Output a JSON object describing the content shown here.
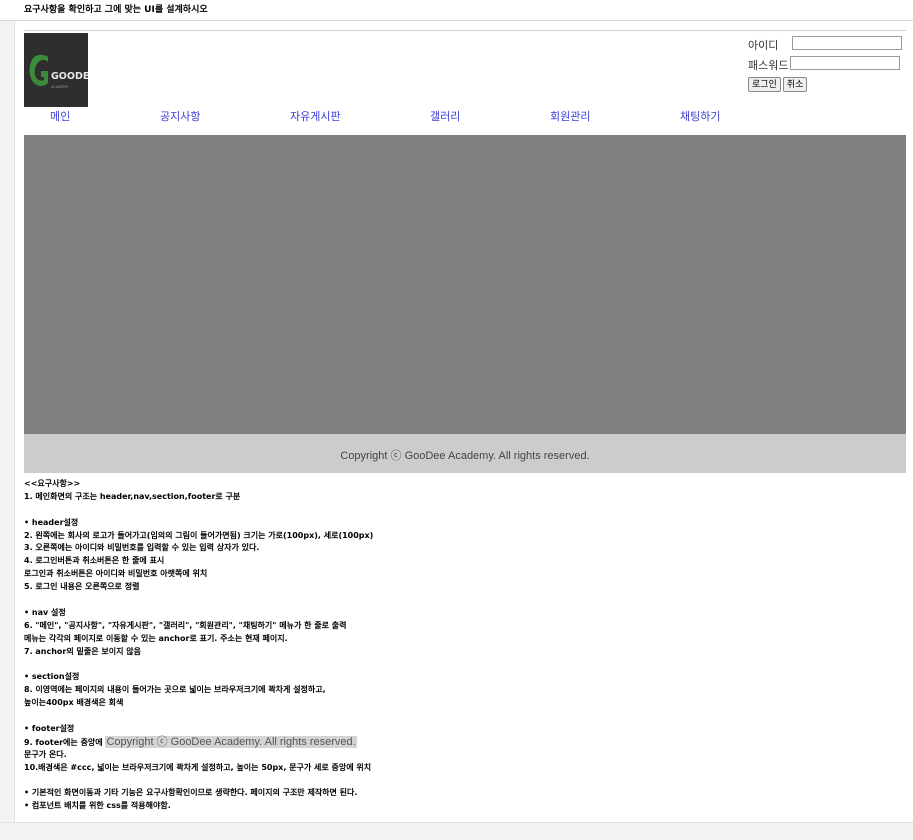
{
  "page_title": "요구사항을 확인하고 그에 맞는 UI를 설계하시오",
  "logo": {
    "alt": "GooDee Academy",
    "text": "GOODEE",
    "subtext": "ACADEMY",
    "bg": "#2e2e2e",
    "accent": "#3c8a3c"
  },
  "login": {
    "id_label": "아이디",
    "pw_label": "패스워드",
    "id_value": "",
    "pw_value": "",
    "login_btn": "로그인",
    "cancel_btn": "취소"
  },
  "nav": [
    {
      "label": "메인"
    },
    {
      "label": "공지사항"
    },
    {
      "label": "자유게시판"
    },
    {
      "label": "갤러리"
    },
    {
      "label": "회원관리"
    },
    {
      "label": "채팅하기"
    }
  ],
  "section": {
    "bg": "#808080"
  },
  "footer": {
    "text": "Copyright ⓒ GooDee Academy. All rights reserved.",
    "bg": "#cccccc"
  },
  "requirements": {
    "heading": "<<요구사항>>",
    "r1": "1. 메인화면의 구조는 header,nav,section,footer로 구분",
    "header_title": "• header설정",
    "r2": "2. 왼쪽에는 회사의 로고가 들어가고(임의의 그림이 들어가면됨) 크기는 가로(100px), 세로(100px)",
    "r3": "3. 오른쪽에는 아이디와 비밀번호를 입력할 수 있는 입력 상자가 있다.",
    "r4": "4. 로그인버튼과 취소버튼은 한 줄에 표시",
    "r4b": "로그인과 취소버튼은 아이디와 비밀번호 아랫쪽에 위치",
    "r5": "5. 로그인 내용은 오른쪽으로 정렬",
    "nav_title": "• nav 설정",
    "r6": "6. \"메인\", \"공지사항\", \"자유게시판\", \"갤러리\", \"회원관리\", \"채팅하기\" 메뉴가 한 줄로 출력",
    "r6b": "메뉴는 각각의 페이지로 이동할 수 있는 anchor로 표기. 주소는 현재 페이지.",
    "r7": "7. anchor의 밑줄은 보이지 않음",
    "section_title": "• section설정",
    "r8": "8. 이영역에는 페이지의 내용이 들어가는 곳으로 넓이는 브라우저크기에 꽉차게 설정하고,",
    "r8b": "높이는400px 배경색은 회색",
    "footer_title": "• footer설정",
    "r9_prefix": "9. footer에는 중앙에",
    "r9_copy": "Copyright ⓒ GooDee Academy. All rights reserved.",
    "r9b": "문구가 온다.",
    "r10": "10.배경색은 #ccc, 넓이는 브라우저크기에 꽉차게 설정하고, 높이는 50px, 문구가 세로 중앙에 위치",
    "note1": "• 기본적인 화면이동과 기타 기능은 요구사항확인이므로 생략한다. 페이지의 구조만 제작하면 된다.",
    "note2": "• 컴포넌트 배치를 위한 css를 적용해야함."
  }
}
